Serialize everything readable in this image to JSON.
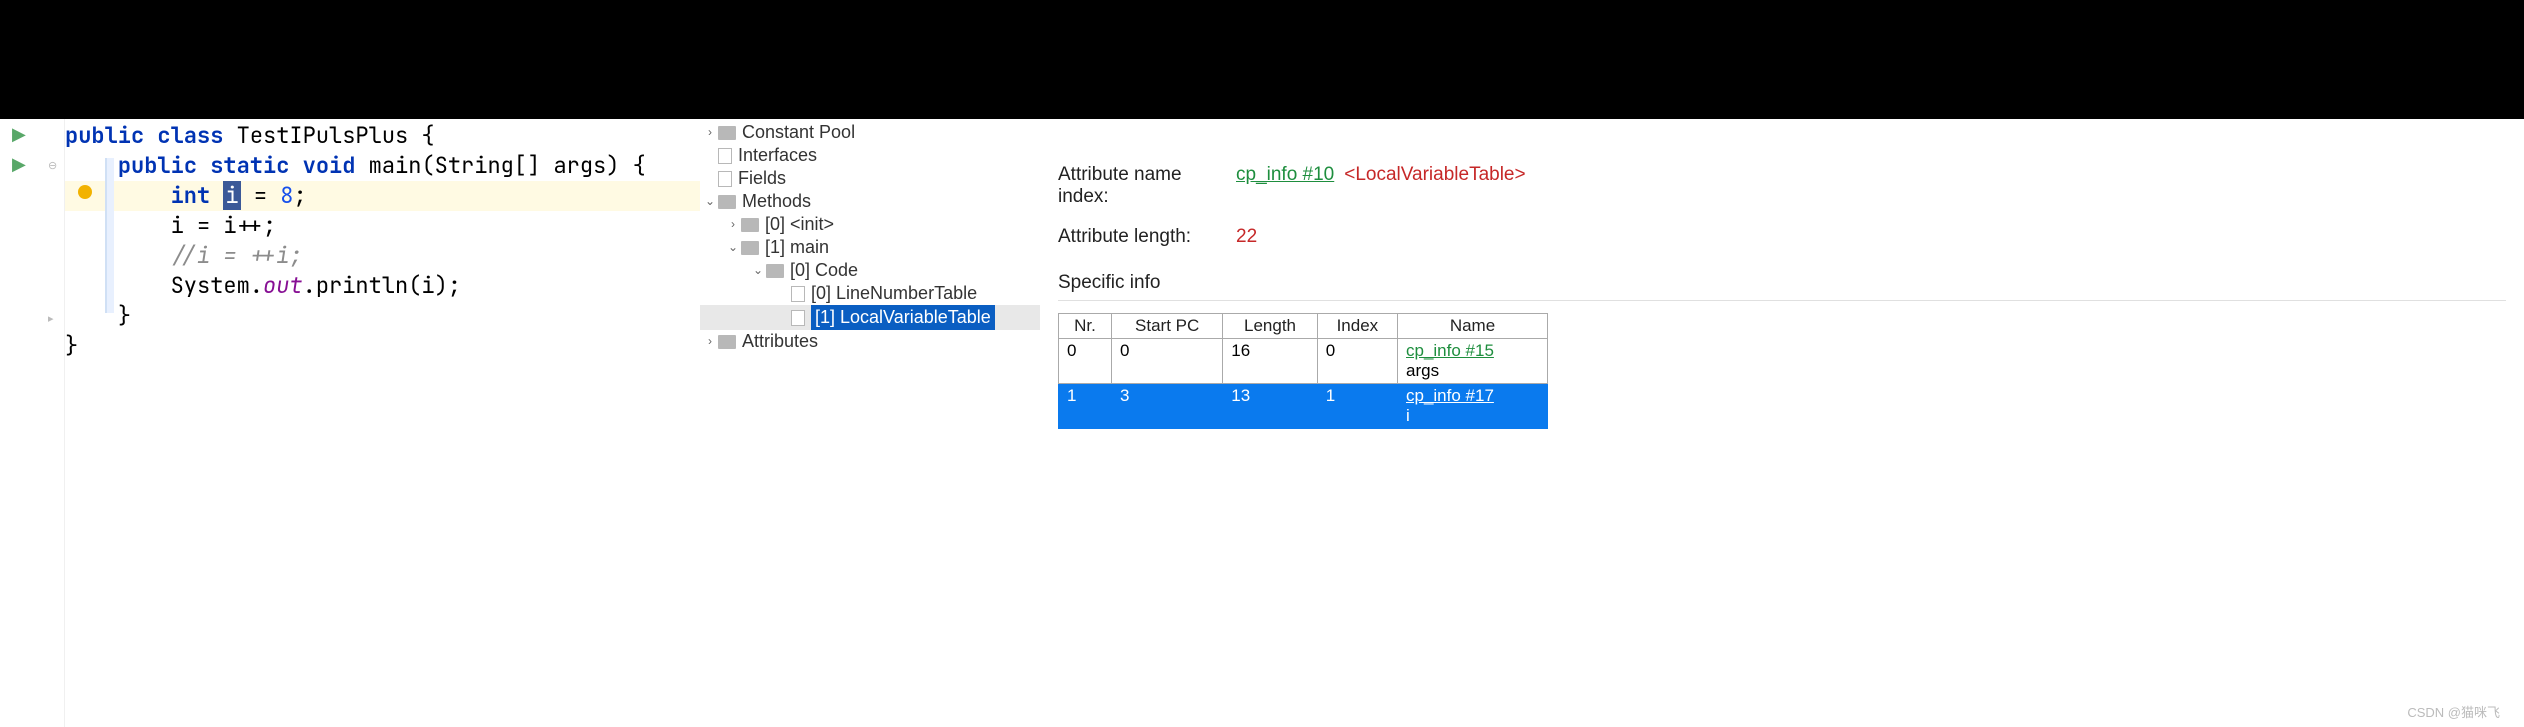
{
  "code": {
    "line1_kw1": "public",
    "line1_kw2": "class",
    "line1_cls": "TestIPulsPlus",
    "line1_brace": " {",
    "line2_kw1": "public",
    "line2_kw2": "static",
    "line2_kw3": "void",
    "line2_name": "main",
    "line2_params": "(String[] args) {",
    "line3_kw": "int",
    "line3_var": "i",
    "line3_rest": " = ",
    "line3_num": "8",
    "line3_semi": ";",
    "line4": "i = i++;",
    "line5": "//i = ++i;",
    "line6_pre": "System.",
    "line6_out": "out",
    "line6_post": ".println(i);",
    "line7": "}",
    "line8": "}"
  },
  "tree": {
    "constant_pool": "Constant Pool",
    "interfaces": "Interfaces",
    "fields": "Fields",
    "methods": "Methods",
    "init": "[0] <init>",
    "main": "[1] main",
    "code": "[0] Code",
    "lnt": "[0] LineNumberTable",
    "lvt": "[1] LocalVariableTable",
    "attributes": "Attributes"
  },
  "info": {
    "attr_name_label": "Attribute name index:",
    "attr_name_link": "cp_info #10",
    "attr_name_tag": "<LocalVariableTable>",
    "attr_len_label": "Attribute length:",
    "attr_len_val": "22",
    "specific": "Specific info"
  },
  "table": {
    "headers": {
      "nr": "Nr.",
      "startpc": "Start PC",
      "length": "Length",
      "index": "Index",
      "name": "Name"
    },
    "rows": [
      {
        "nr": "0",
        "startpc": "0",
        "length": "16",
        "index": "0",
        "name_link": "cp_info #15",
        "name_plain": "args",
        "selected": false
      },
      {
        "nr": "1",
        "startpc": "3",
        "length": "13",
        "index": "1",
        "name_link": "cp_info #17",
        "name_plain": "i",
        "selected": true
      }
    ]
  },
  "watermark": "CSDN @猫咪飞"
}
